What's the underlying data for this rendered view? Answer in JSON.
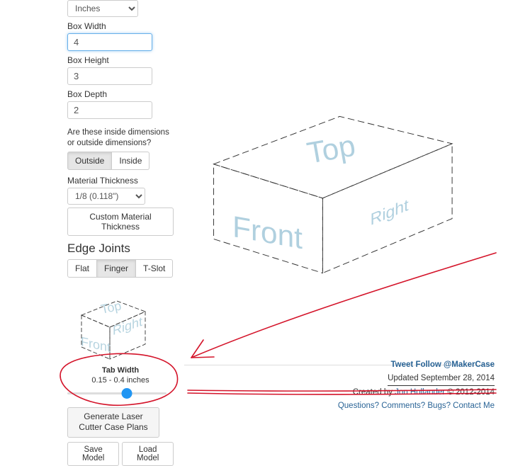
{
  "units_select": "Inches",
  "box_width": {
    "label": "Box Width",
    "value": "4"
  },
  "box_height": {
    "label": "Box Height",
    "value": "3"
  },
  "box_depth": {
    "label": "Box Depth",
    "value": "2"
  },
  "dims_question": "Are these inside dimensions or outside dimensions?",
  "dims_buttons": {
    "outside": "Outside",
    "inside": "Inside"
  },
  "material_thickness": {
    "label": "Material Thickness",
    "value": "1/8 (0.118\")"
  },
  "custom_thickness_btn": "Custom Material Thickness",
  "edge_joints": {
    "heading": "Edge Joints",
    "flat": "Flat",
    "finger": "Finger",
    "tslot": "T-Slot"
  },
  "thumb_faces": {
    "top": "Top",
    "front": "Front",
    "right": "Right"
  },
  "tab_width": {
    "label": "Tab Width",
    "range": "0.15 - 0.4 inches"
  },
  "generate_btn": "Generate Laser Cutter Case Plans",
  "save_btn": "Save Model",
  "load_btn": "Load Model",
  "preview_faces": {
    "top": "Top",
    "front": "Front",
    "right": "Right"
  },
  "footer": {
    "tweet": "Tweet",
    "follow": "Follow @MakerCase",
    "updated": "Updated September 28, 2014",
    "created_by_pre": "Created by ",
    "created_by_link": "Jon Hollander",
    "created_by_post": " © 2012-2014",
    "contact": "Questions? Comments? Bugs? Contact Me"
  }
}
